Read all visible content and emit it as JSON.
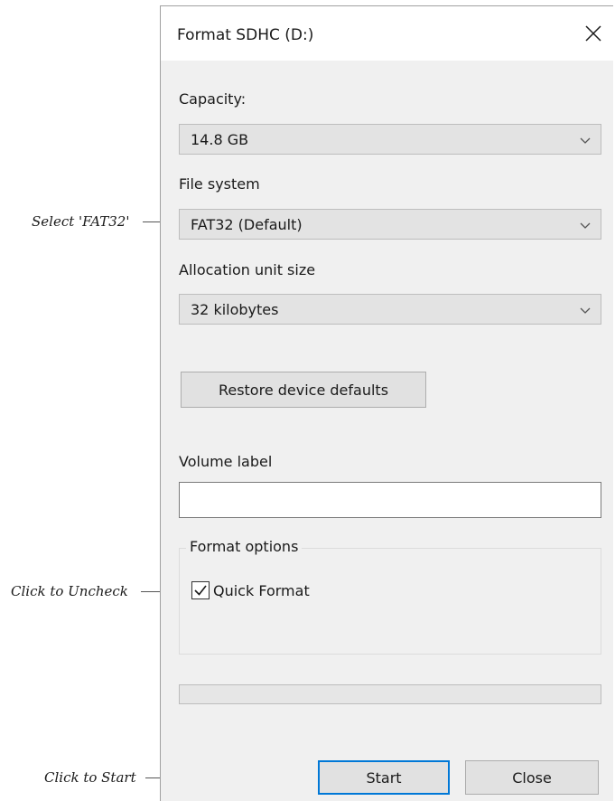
{
  "dialog": {
    "title": "Format SDHC (D:)",
    "close_icon": "close-icon",
    "capacity": {
      "label": "Capacity:",
      "value": "14.8 GB"
    },
    "file_system": {
      "label": "File system",
      "value": "FAT32 (Default)"
    },
    "allocation": {
      "label": "Allocation unit size",
      "value": "32 kilobytes"
    },
    "restore_button": "Restore device defaults",
    "volume_label": {
      "label": "Volume label",
      "value": ""
    },
    "format_options": {
      "title": "Format options",
      "quick_format": {
        "label": "Quick Format",
        "checked": true
      }
    },
    "progress": {
      "value": 0
    },
    "start_button": "Start",
    "close_button": "Close",
    "colors": {
      "dialog_bg": "#f0f0f0",
      "focus_border": "#0078d7",
      "progress_fill": "#06b025"
    }
  },
  "annotations": {
    "select_fat32": "Select 'FAT32'",
    "uncheck": "Click to Uncheck",
    "start": "Click to Start"
  }
}
